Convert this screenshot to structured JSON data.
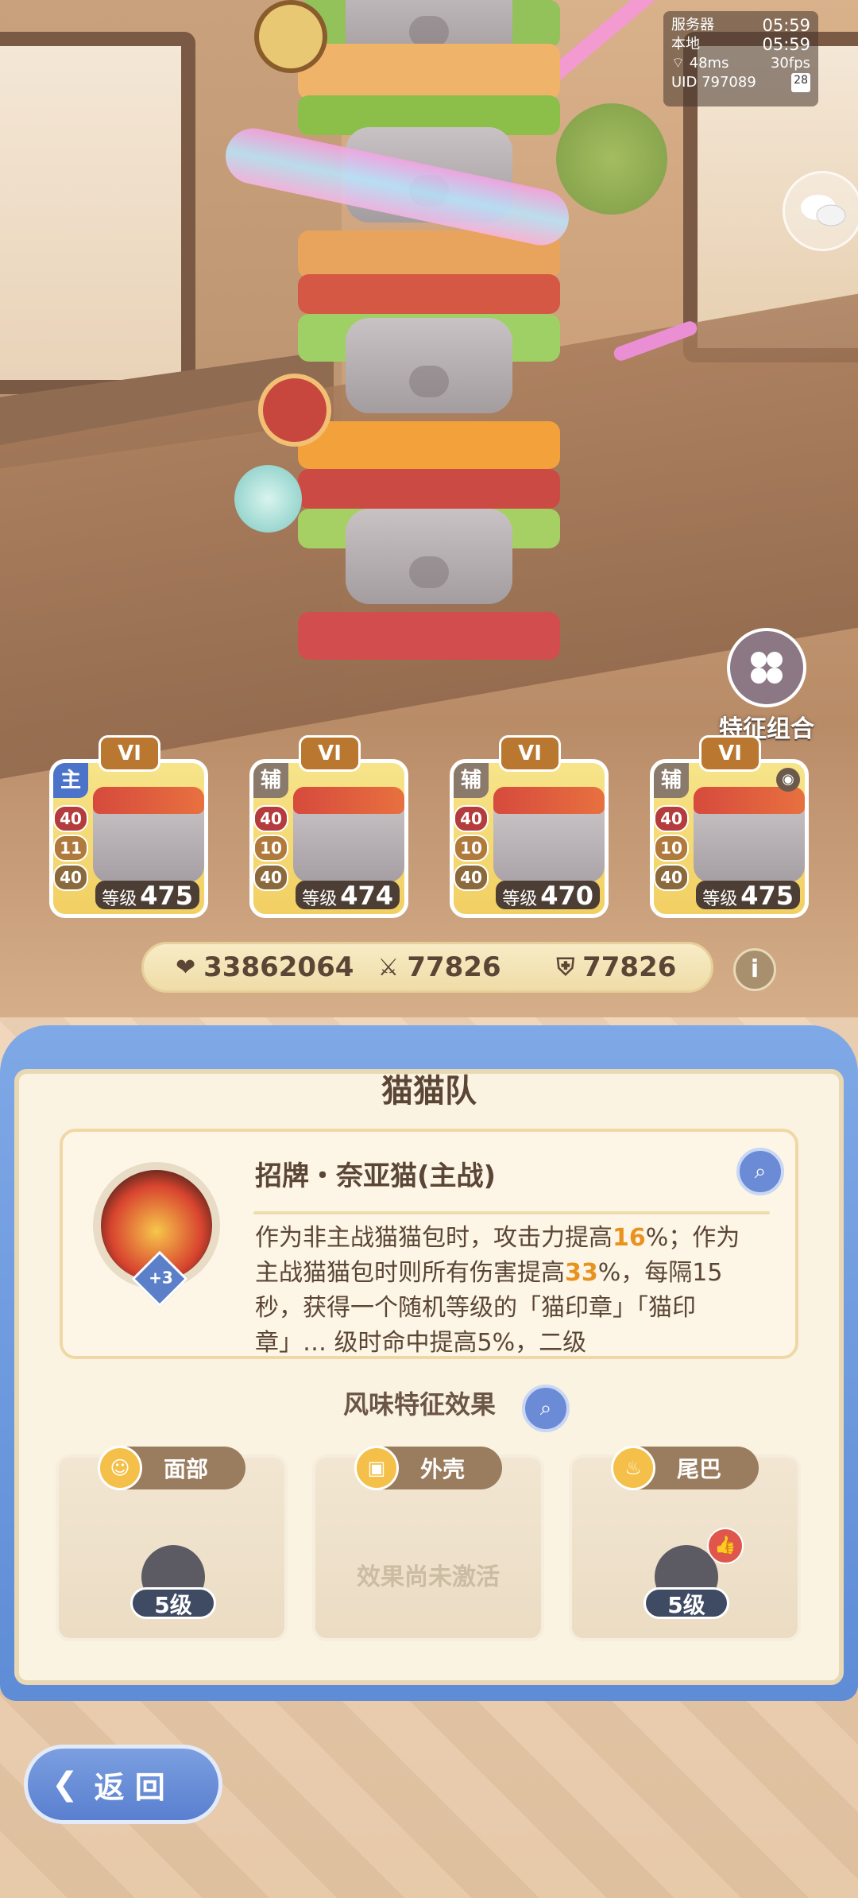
{
  "hud": {
    "server_label": "服务器",
    "server_time": "05:59",
    "local_label": "本地",
    "local_time": "05:59",
    "ping": "48ms",
    "fps": "30fps",
    "uid": "UID 797089",
    "battery": "28"
  },
  "feature_combo": {
    "label": "特征组合"
  },
  "cards": [
    {
      "rank": "VI",
      "role": "主",
      "stats": [
        "40",
        "11",
        "40"
      ],
      "level_label": "等级",
      "level": "475"
    },
    {
      "rank": "VI",
      "role": "辅",
      "stats": [
        "40",
        "10",
        "40"
      ],
      "level_label": "等级",
      "level": "474"
    },
    {
      "rank": "VI",
      "role": "辅",
      "stats": [
        "40",
        "10",
        "40"
      ],
      "level_label": "等级",
      "level": "470"
    },
    {
      "rank": "VI",
      "role": "辅",
      "stats": [
        "40",
        "10",
        "40"
      ],
      "level_label": "等级",
      "level": "475"
    }
  ],
  "team_stats": {
    "hp": "33862064",
    "attack": "77826",
    "defense": "77826"
  },
  "panel": {
    "title": "猫猫队",
    "skill": {
      "name": "招牌・奈亚猫(主战)",
      "badge": "+3",
      "desc_parts": [
        "作为非主战猫猫包时，攻击力提高",
        "16",
        "%；作为主战猫猫包时则所有伤害提高",
        "33",
        "%，每隔15秒，获得一个随机等级的「猫印章",
        "」「猫印章」… 级时命中提高5%，二级"
      ]
    },
    "flavor_title": "风味特征效果",
    "flavors": [
      {
        "tag": "面部",
        "level": "5级"
      },
      {
        "tag": "外壳",
        "inactive": "效果尚未激活"
      },
      {
        "tag": "尾巴",
        "level": "5级"
      }
    ]
  },
  "back": {
    "label": "返 回"
  },
  "colors": {
    "accent_blue": "#5e8cd6",
    "highlight": "#e89320",
    "text_brown": "#5b4636"
  }
}
